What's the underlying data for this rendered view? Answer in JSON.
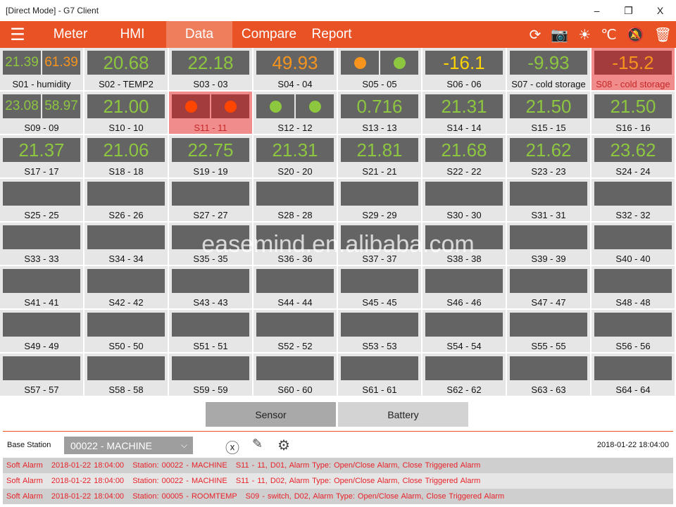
{
  "window": {
    "title": "[Direct Mode] - G7 Client",
    "minimize": "–",
    "restore": "❐",
    "close": "X"
  },
  "nav": {
    "menu_icon": "☰",
    "tabs": [
      {
        "label": "Meter"
      },
      {
        "label": "HMI"
      },
      {
        "label": "Data",
        "active": true
      },
      {
        "label": "Compare"
      },
      {
        "label": "Report"
      }
    ],
    "icons": [
      {
        "name": "sync-icon",
        "glyph": "⟳"
      },
      {
        "name": "camera-icon",
        "glyph": "📷"
      },
      {
        "name": "brightness-icon",
        "glyph": "☀"
      },
      {
        "name": "celsius-icon",
        "glyph": "℃"
      },
      {
        "name": "mute-alarm-icon",
        "glyph": "🔕"
      },
      {
        "name": "clear-icon",
        "glyph": "🗑"
      }
    ]
  },
  "colors": {
    "accent": "#e85225",
    "green": "#8dc63f",
    "orange": "#f7941d",
    "yellow": "#ffd400",
    "red_led": "#ff4500"
  },
  "cells": [
    {
      "label": "S01 - humidity",
      "type": "dual",
      "values": [
        "21.39",
        "61.39"
      ],
      "colors": [
        "#8dc63f",
        "#f7941d"
      ]
    },
    {
      "label": "S02 - TEMP2",
      "type": "single",
      "values": [
        "20.68"
      ],
      "colors": [
        "#8dc63f"
      ]
    },
    {
      "label": "S03 - 03",
      "type": "single",
      "values": [
        "22.18"
      ],
      "colors": [
        "#8dc63f"
      ]
    },
    {
      "label": "S04 - 04",
      "type": "single",
      "values": [
        "49.93"
      ],
      "colors": [
        "#f7941d"
      ]
    },
    {
      "label": "S05 - 05",
      "type": "leds",
      "colors": [
        "#f7941d",
        "#8dc63f"
      ]
    },
    {
      "label": "S06 - 06",
      "type": "single",
      "values": [
        "-16.1"
      ],
      "colors": [
        "#ffd400"
      ]
    },
    {
      "label": "S07 - cold storage",
      "type": "single",
      "values": [
        "-9.93"
      ],
      "colors": [
        "#8dc63f"
      ]
    },
    {
      "label": "S08 - cold storage",
      "type": "single",
      "values": [
        "-15.2"
      ],
      "colors": [
        "#f7941d"
      ],
      "alarm": true
    },
    {
      "label": "S09 - 09",
      "type": "dual",
      "values": [
        "23.08",
        "58.97"
      ],
      "colors": [
        "#8dc63f",
        "#8dc63f"
      ]
    },
    {
      "label": "S10 - 10",
      "type": "single",
      "values": [
        "21.00"
      ],
      "colors": [
        "#8dc63f"
      ]
    },
    {
      "label": "S11 - 11",
      "type": "leds",
      "colors": [
        "#ff4500",
        "#ff4500"
      ],
      "alarm": true
    },
    {
      "label": "S12 - 12",
      "type": "leds",
      "colors": [
        "#8dc63f",
        "#8dc63f"
      ]
    },
    {
      "label": "S13 - 13",
      "type": "single",
      "values": [
        "0.716"
      ],
      "colors": [
        "#8dc63f"
      ]
    },
    {
      "label": "S14 - 14",
      "type": "single",
      "values": [
        "21.31"
      ],
      "colors": [
        "#8dc63f"
      ]
    },
    {
      "label": "S15 - 15",
      "type": "single",
      "values": [
        "21.50"
      ],
      "colors": [
        "#8dc63f"
      ]
    },
    {
      "label": "S16 - 16",
      "type": "single",
      "values": [
        "21.50"
      ],
      "colors": [
        "#8dc63f"
      ]
    },
    {
      "label": "S17 - 17",
      "type": "single",
      "values": [
        "21.37"
      ],
      "colors": [
        "#8dc63f"
      ]
    },
    {
      "label": "S18 - 18",
      "type": "single",
      "values": [
        "21.06"
      ],
      "colors": [
        "#8dc63f"
      ]
    },
    {
      "label": "S19 - 19",
      "type": "single",
      "values": [
        "22.75"
      ],
      "colors": [
        "#8dc63f"
      ]
    },
    {
      "label": "S20 - 20",
      "type": "single",
      "values": [
        "21.31"
      ],
      "colors": [
        "#8dc63f"
      ]
    },
    {
      "label": "S21 - 21",
      "type": "single",
      "values": [
        "21.81"
      ],
      "colors": [
        "#8dc63f"
      ]
    },
    {
      "label": "S22 - 22",
      "type": "single",
      "values": [
        "21.68"
      ],
      "colors": [
        "#8dc63f"
      ]
    },
    {
      "label": "S23 - 23",
      "type": "single",
      "values": [
        "21.62"
      ],
      "colors": [
        "#8dc63f"
      ]
    },
    {
      "label": "S24 - 24",
      "type": "single",
      "values": [
        "23.62"
      ],
      "colors": [
        "#8dc63f"
      ]
    },
    {
      "label": "S25 - 25"
    },
    {
      "label": "S26 - 26"
    },
    {
      "label": "S27 - 27"
    },
    {
      "label": "S28 - 28"
    },
    {
      "label": "S29 - 29"
    },
    {
      "label": "S30 - 30"
    },
    {
      "label": "S31 - 31"
    },
    {
      "label": "S32 - 32"
    },
    {
      "label": "S33 - 33"
    },
    {
      "label": "S34 - 34"
    },
    {
      "label": "S35 - 35"
    },
    {
      "label": "S36 - 36"
    },
    {
      "label": "S37 - 37"
    },
    {
      "label": "S38 - 38"
    },
    {
      "label": "S39 - 39"
    },
    {
      "label": "S40 - 40"
    },
    {
      "label": "S41 - 41"
    },
    {
      "label": "S42 - 42"
    },
    {
      "label": "S43 - 43"
    },
    {
      "label": "S44 - 44"
    },
    {
      "label": "S45 - 45"
    },
    {
      "label": "S46 - 46"
    },
    {
      "label": "S47 - 47"
    },
    {
      "label": "S48 - 48"
    },
    {
      "label": "S49 - 49"
    },
    {
      "label": "S50 - 50"
    },
    {
      "label": "S51 - 51"
    },
    {
      "label": "S52 - 52"
    },
    {
      "label": "S53 - 53"
    },
    {
      "label": "S54 - 54"
    },
    {
      "label": "S55 - 55"
    },
    {
      "label": "S56 - 56"
    },
    {
      "label": "S57 - 57"
    },
    {
      "label": "S58 - 58"
    },
    {
      "label": "S59 - 59"
    },
    {
      "label": "S60 - 60"
    },
    {
      "label": "S61 - 61"
    },
    {
      "label": "S62 - 62"
    },
    {
      "label": "S63 - 63"
    },
    {
      "label": "S64 - 64"
    }
  ],
  "watermark": "easemind.en.alibaba.com",
  "view_buttons": {
    "sensor": "Sensor",
    "battery": "Battery"
  },
  "base_station": {
    "label": "Base Station",
    "selected": "00022 - MACHINE",
    "timestamp": "2018-01-22 18:04:00"
  },
  "alarms": [
    "Soft Alarm   2018-01-22 18:04:00   Station: 00022 - MACHINE   S11 - 11, D01, Alarm Type: Open/Close Alarm, Close Triggered Alarm",
    "Soft Alarm   2018-01-22 18:04:00   Station: 00022 - MACHINE   S11 - 11, D02, Alarm Type: Open/Close Alarm, Close Triggered Alarm",
    "Soft Alarm   2018-01-22 18:04:00   Station: 00005 - ROOMTEMP   S09 - switch, D02, Alarm Type: Open/Close Alarm, Close Triggered Alarm"
  ]
}
